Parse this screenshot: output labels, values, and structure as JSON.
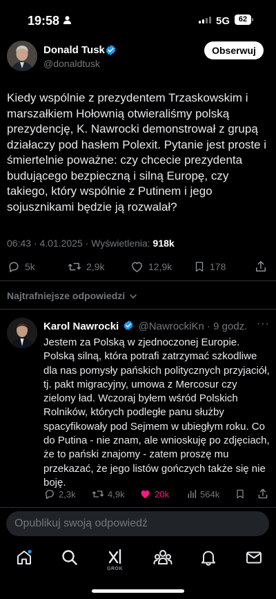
{
  "status_bar": {
    "time": "19:58",
    "network": "5G",
    "battery": "62"
  },
  "tweet": {
    "author_name": "Donald Tusk",
    "author_handle": "@donaldtusk",
    "follow_label": "Obserwuj",
    "text": "Kiedy wspólnie z prezydentem Trzaskowskim i marszałkiem Hołownią otwieraliśmy polską prezydencję, K. Nawrocki demonstrował z grupą działaczy pod hasłem Polexit. Pytanie jest proste i śmiertelnie poważne: czy chcecie prezydenta budującego bezpieczną i silną Europę, czy takiego, który wspólnie z Putinem i jego sojusznikami będzie ją rozwalał?",
    "timestamp": "06:43 · 4.01.2025 · Wyświetlenia: ",
    "views": "918k",
    "stats": {
      "replies": "5k",
      "reposts": "2,9k",
      "likes": "12,9k",
      "bookmarks": "178"
    }
  },
  "replies_sort_label": "Najtrafniejsze odpowiedzi",
  "reply": {
    "author_name": "Karol Nawrocki",
    "author_handle": "@NawrockiKn",
    "time": " · 9 godz.",
    "text": "Jestem za Polską w zjednoczonej Europie. Polską silną, która potrafi zatrzymać szkodliwe dla nas pomysły pańskich politycznych przyjaciół, tj. pakt migracyjny, umowa z Mercosur czy zielony ład. Wczoraj byłem wśród Polskich Rolników, których podległe panu służby spacyfikowały pod Sejmem w ubiegłym roku. Co do Putina - nie znam, ale wnioskuję po zdjęciach, że to pański znajomy - zatem proszę mu przekazać, że jego listów gończych także się nie boję.",
    "stats": {
      "replies": "2,3k",
      "reposts": "4,9k",
      "likes": "20k",
      "views": "564k"
    }
  },
  "compose_placeholder": "Opublikuj swoją odpowiedź",
  "tabbar": {
    "grok_label": "GROK"
  },
  "colors": {
    "background": "#000000",
    "text": "#e7e9ea",
    "muted": "#71767b",
    "verified": "#1d9bf0",
    "like_active": "#f91880",
    "divider": "#2f3336"
  }
}
